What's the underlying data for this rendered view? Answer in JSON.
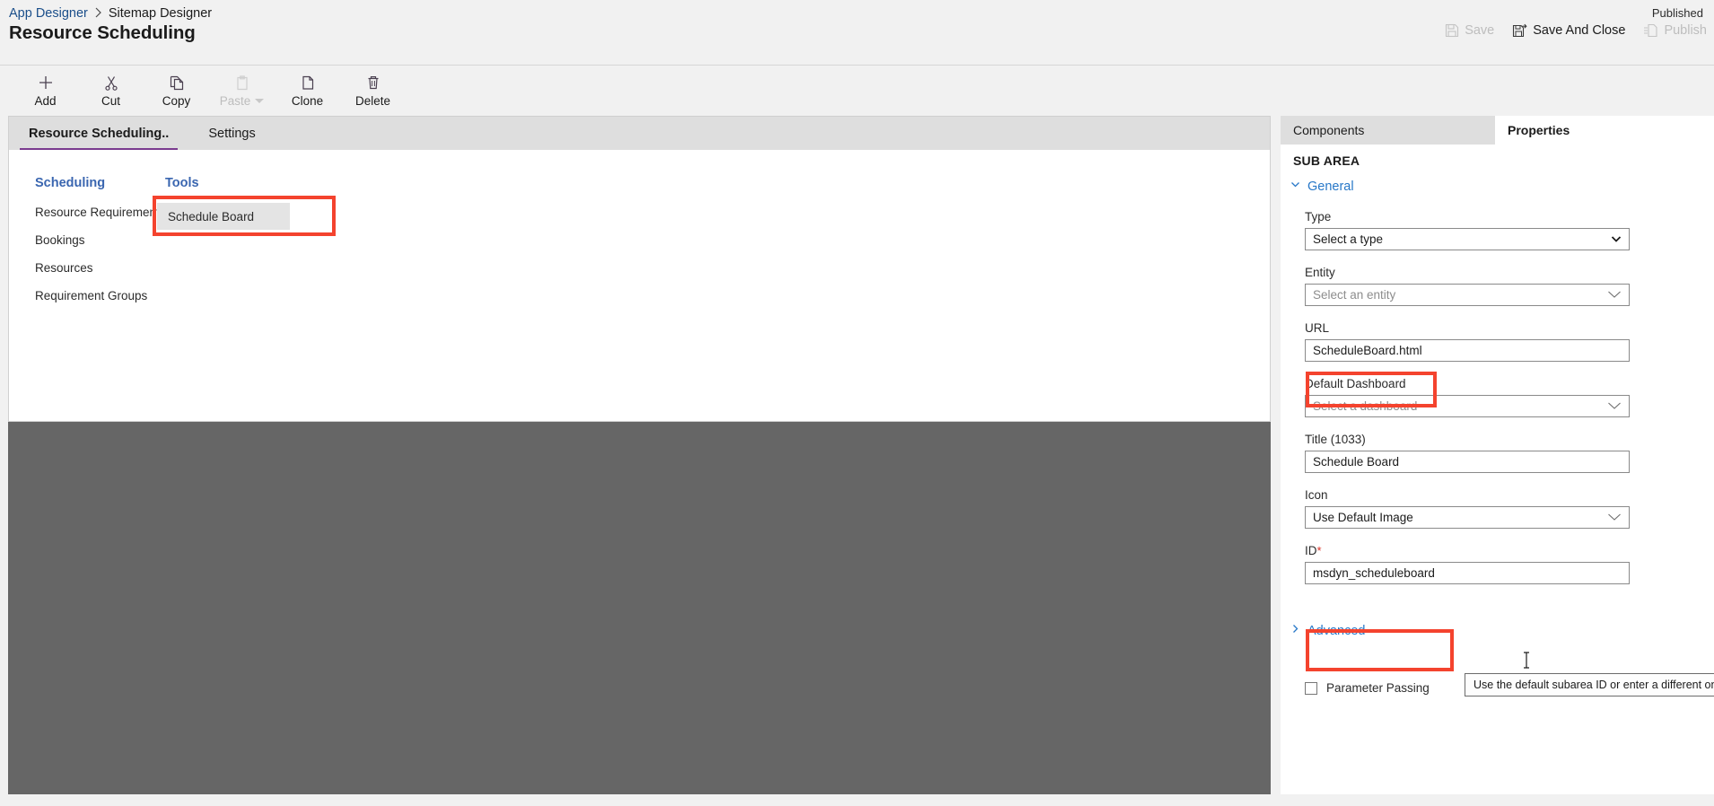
{
  "header": {
    "breadcrumb": [
      "App Designer",
      "Sitemap Designer"
    ],
    "page_title": "Resource Scheduling",
    "published_status": "Published",
    "actions": [
      {
        "label": "Save",
        "icon": "save-icon",
        "disabled": true
      },
      {
        "label": "Save And Close",
        "icon": "save-and-close-icon",
        "disabled": false
      },
      {
        "label": "Publish",
        "icon": "publish-icon",
        "disabled": true
      }
    ]
  },
  "toolbar": {
    "items": [
      {
        "label": "Add",
        "icon": "plus-icon",
        "disabled": false,
        "caret": false
      },
      {
        "label": "Cut",
        "icon": "scissors-icon",
        "disabled": false,
        "caret": false
      },
      {
        "label": "Copy",
        "icon": "copy-icon",
        "disabled": false,
        "caret": false
      },
      {
        "label": "Paste",
        "icon": "clipboard-icon",
        "disabled": true,
        "caret": true
      },
      {
        "label": "Clone",
        "icon": "clone-icon",
        "disabled": false,
        "caret": false
      },
      {
        "label": "Delete",
        "icon": "trash-icon",
        "disabled": false,
        "caret": false
      }
    ]
  },
  "canvas": {
    "tabs": [
      {
        "label": "Resource Scheduling..",
        "active": true
      },
      {
        "label": "Settings",
        "active": false
      }
    ],
    "group_title": "Scheduling",
    "tools_title": "Tools",
    "nav_items": [
      "Resource Requirements",
      "Bookings",
      "Resources",
      "Requirement Groups"
    ],
    "selected_tile": "Schedule Board"
  },
  "properties": {
    "tabs": [
      {
        "label": "Components",
        "active": false
      },
      {
        "label": "Properties",
        "active": true
      }
    ],
    "section_heading": "SUB AREA",
    "general_label": "General",
    "advanced_label": "Advanced",
    "fields": [
      {
        "label": "Type",
        "value": "Select a type",
        "kind": "select",
        "placeholder": false
      },
      {
        "label": "Entity",
        "value": "Select an entity",
        "kind": "dropdown",
        "placeholder": true
      },
      {
        "label": "URL",
        "value": "ScheduleBoard.html",
        "kind": "text",
        "placeholder": false
      },
      {
        "label": "Default Dashboard",
        "value": "Select a dashboard",
        "kind": "dropdown",
        "placeholder": true
      },
      {
        "label": "Title (1033)",
        "value": "Schedule Board",
        "kind": "text",
        "placeholder": false
      },
      {
        "label": "Icon",
        "value": "Use Default Image",
        "kind": "dropdown",
        "placeholder": false
      },
      {
        "label": "ID",
        "value": "msdyn_scheduleboard",
        "kind": "text",
        "placeholder": false,
        "required": true,
        "required_marker": "*"
      }
    ],
    "parameter_passing_label": "Parameter Passing",
    "parameter_passing_checked": false,
    "tooltip_text": "Use the default subarea ID or enter a different one."
  },
  "colors": {
    "highlight_red": "#f4432e",
    "accent_purple": "#7a3b8f",
    "link_blue": "#2878c8",
    "overlay_gray": "#666666"
  }
}
